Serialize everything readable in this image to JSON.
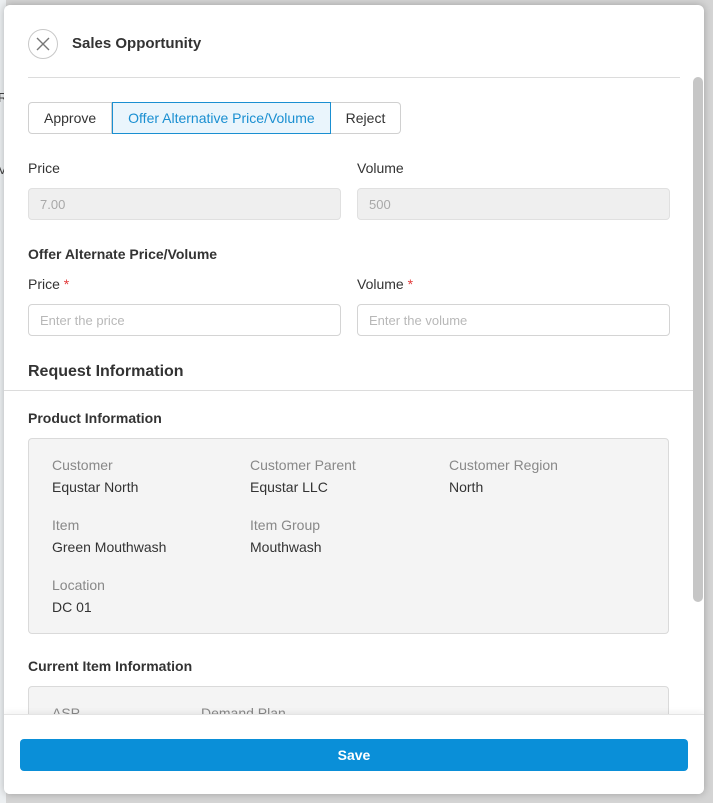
{
  "background": {
    "glyph_1": "R",
    "glyph_2": "V"
  },
  "modal": {
    "title": "Sales Opportunity",
    "close_icon": "close-icon"
  },
  "tabs": [
    {
      "label": "Approve",
      "active": false
    },
    {
      "label": "Offer Alternative Price/Volume",
      "active": true
    },
    {
      "label": "Reject",
      "active": false
    }
  ],
  "current": {
    "price_label": "Price",
    "price_value": "7.00",
    "volume_label": "Volume",
    "volume_value": "500"
  },
  "offer": {
    "heading": "Offer Alternate Price/Volume",
    "price_label": "Price",
    "price_placeholder": "Enter the price",
    "volume_label": "Volume",
    "volume_placeholder": "Enter the volume",
    "required_marker": "*"
  },
  "request": {
    "heading": "Request Information",
    "product_heading": "Product Information",
    "fields": [
      {
        "key": "Customer",
        "value": "Equstar North"
      },
      {
        "key": "Customer Parent",
        "value": "Equstar LLC"
      },
      {
        "key": "Customer Region",
        "value": "North"
      },
      {
        "key": "Item",
        "value": "Green Mouthwash"
      },
      {
        "key": "Item Group",
        "value": "Mouthwash"
      },
      {
        "key": "Location",
        "value": "DC 01"
      }
    ],
    "current_item_heading": "Current Item Information",
    "current_item_fields": [
      {
        "key": "ASP"
      },
      {
        "key": "Demand Plan"
      }
    ]
  },
  "footer": {
    "save_label": "Save"
  },
  "colors": {
    "accent": "#0a8fd8",
    "tab_active": "#1a8fd1",
    "required": "#e23b3b"
  }
}
